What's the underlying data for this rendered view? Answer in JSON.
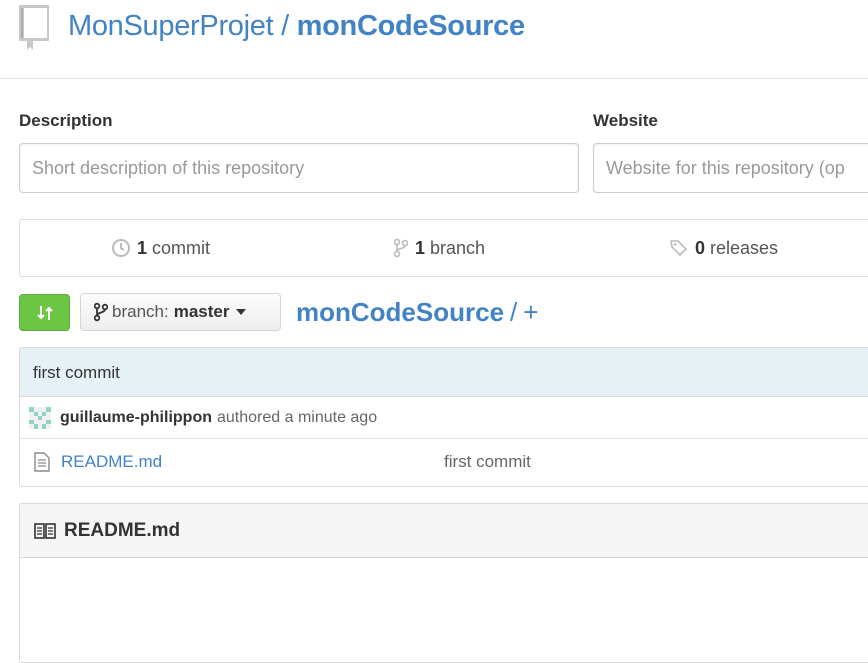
{
  "repo": {
    "owner": "MonSuperProjet",
    "separator": " / ",
    "name": "monCodeSource"
  },
  "fields": {
    "description_label": "Description",
    "description_placeholder": "Short description of this repository",
    "website_label": "Website",
    "website_placeholder": "Website for this repository (op"
  },
  "stats": {
    "commits_count": "1",
    "commits_label": "commit",
    "branches_count": "1",
    "branches_label": "branch",
    "releases_count": "0",
    "releases_label": "releases"
  },
  "toolbar": {
    "branch_prefix": "branch:",
    "branch_name": "master",
    "breadcrumb_root": "monCodeSource",
    "breadcrumb_sep": "/",
    "breadcrumb_add": "+"
  },
  "commit": {
    "message": "first commit",
    "author": "guillaume-philippon",
    "time_text": "authored a minute ago"
  },
  "files": [
    {
      "name": "README.md",
      "message": "first commit"
    }
  ],
  "readme": {
    "title": "README.md"
  },
  "colors": {
    "link": "#4183c4",
    "compare_green": "#6cc644",
    "commit_bg": "#e6f1f6"
  }
}
